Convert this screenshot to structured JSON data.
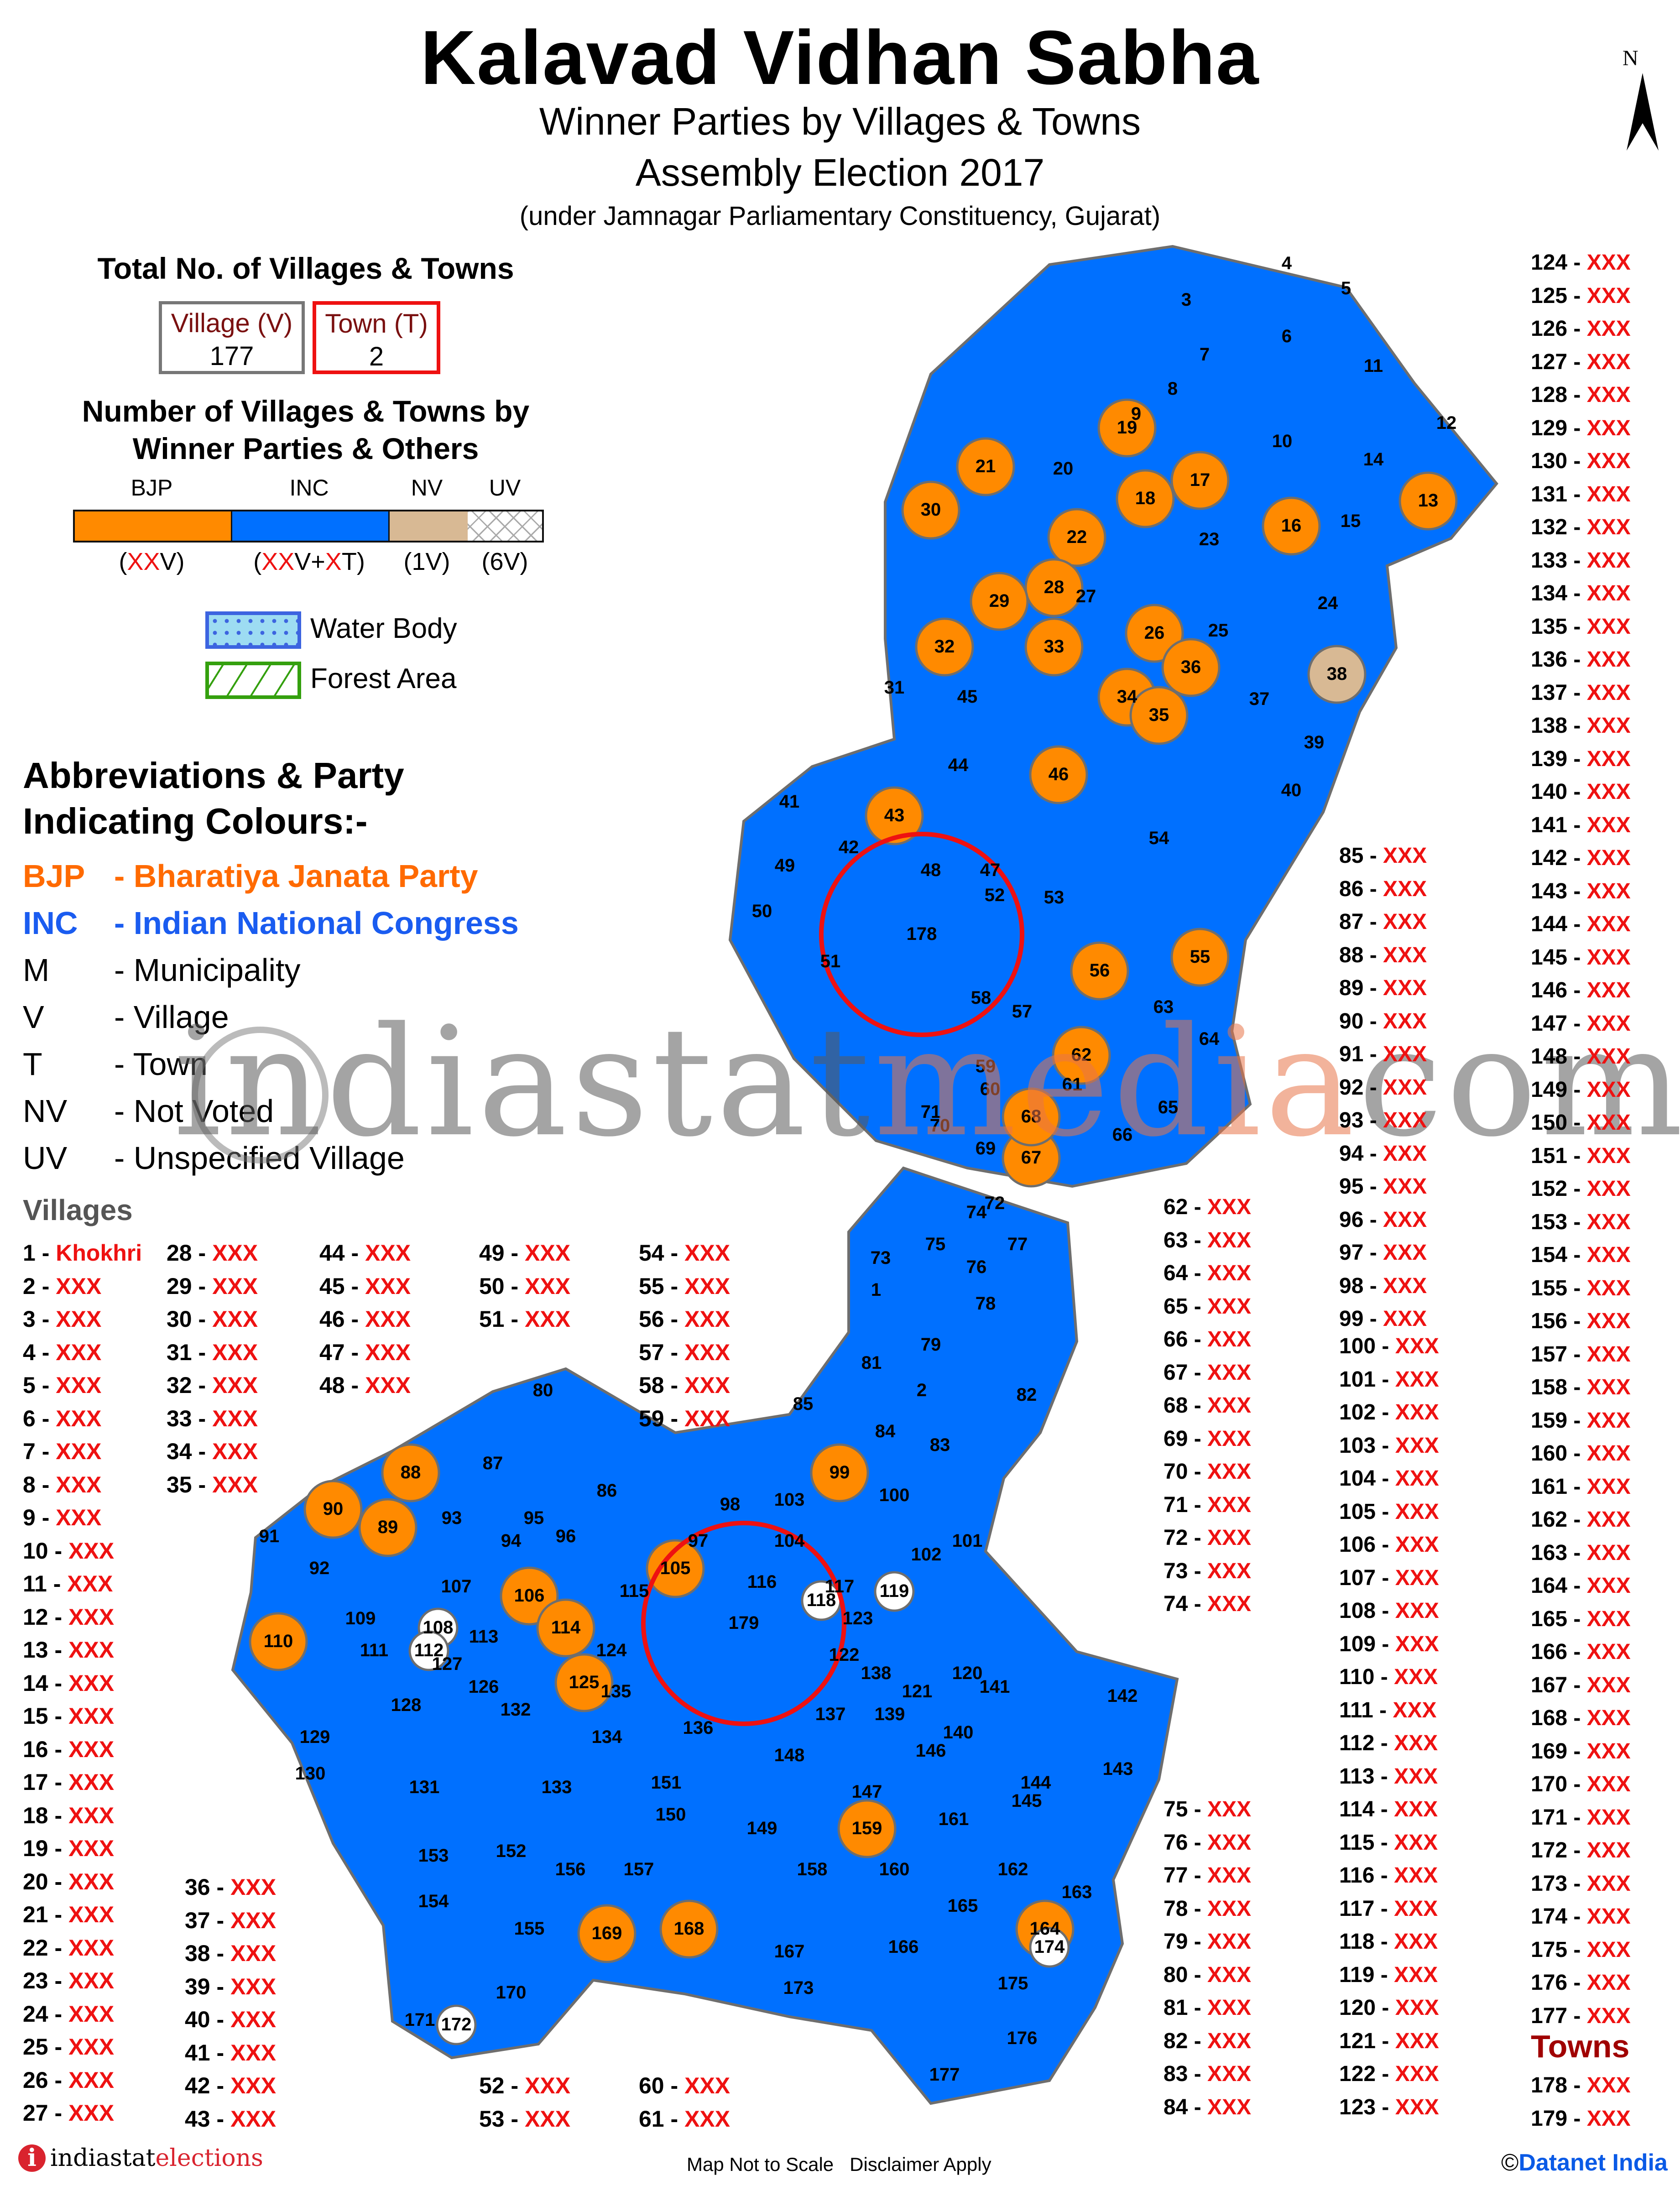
{
  "header": {
    "title": "Kalavad Vidhan Sabha",
    "subtitle_1": "Winner Parties by Villages & Towns",
    "subtitle_2": "Assembly Election 2017",
    "subtitle_3": "(under Jamnagar Parliamentary Constituency, Gujarat)",
    "north_label": "N"
  },
  "totals": {
    "heading": "Total No. of Villages & Towns",
    "village_label": "Village (V)",
    "village_count": "177",
    "town_label": "Town (T)",
    "town_count": "2"
  },
  "party_legend": {
    "heading": "Number of Villages & Towns by Winner Parties & Others",
    "items": [
      {
        "label": "BJP",
        "color": "#ff8a00",
        "count_prefix": "(",
        "count_red": "XX",
        "count_suffix": "V)"
      },
      {
        "label": "INC",
        "color": "#0070ff",
        "count_prefix": "(",
        "count_red": "XX",
        "count_mid": "V+",
        "count_red2": "X",
        "count_suffix": "T)"
      },
      {
        "label": "NV",
        "color": "#d8b994",
        "count_text": "(1V)"
      },
      {
        "label": "UV",
        "color": "#ffffff",
        "count_text": "(6V)"
      }
    ]
  },
  "area_legend": {
    "water_body": "Water Body",
    "forest_area": "Forest Area"
  },
  "abbreviations": {
    "heading_1": "Abbreviations & Party",
    "heading_2": "Indicating Colours:-",
    "items": [
      {
        "key": "BJP",
        "sep": "-",
        "value": "Bharatiya Janata Party",
        "color": "#ff6a00"
      },
      {
        "key": "INC",
        "sep": "-",
        "value": "Indian National Congress",
        "color": "#1a5cf0"
      },
      {
        "key": "M",
        "sep": "-",
        "value": "Municipality",
        "color": "#000000"
      },
      {
        "key": "V",
        "sep": "-",
        "value": "Village",
        "color": "#000000"
      },
      {
        "key": "T",
        "sep": "-",
        "value": "Town",
        "color": "#000000"
      },
      {
        "key": "NV",
        "sep": "-",
        "value": "Not Voted",
        "color": "#000000"
      },
      {
        "key": "UV",
        "sep": "-",
        "value": "Unspecified Village",
        "color": "#000000"
      }
    ]
  },
  "villages_heading": "Villages",
  "village_names": {
    "1": "Khokhri"
  },
  "placeholder_name": "XXX",
  "towns_heading": "Towns",
  "map": {
    "colors": {
      "BJP": "#ff8a00",
      "INC": "#0070ff",
      "NV": "#d8b994",
      "UV": "#ffffff",
      "border": "#6e6e6e",
      "town_outline": "#ee1111"
    },
    "regions": {
      "BJP": [
        13,
        16,
        17,
        18,
        19,
        21,
        22,
        26,
        28,
        29,
        30,
        32,
        33,
        34,
        35,
        36,
        43,
        46,
        55,
        56,
        62,
        67,
        68,
        88,
        89,
        90,
        99,
        105,
        106,
        110,
        114,
        125,
        159,
        164,
        168,
        169
      ],
      "NV": [
        38
      ],
      "UV": [
        108,
        112,
        118,
        119,
        172,
        174
      ],
      "towns": [
        178,
        179
      ]
    }
  },
  "watermark": {
    "part1": "indiastat",
    "part2": "media",
    "part3": "com"
  },
  "footer": {
    "logo_i": "i",
    "logo_part1": "indiastat",
    "logo_part2": "elections",
    "note": "Map Not to Scale   Disclaimer Apply",
    "copyright_symbol": "©",
    "copyright_text": "Datanet India"
  }
}
